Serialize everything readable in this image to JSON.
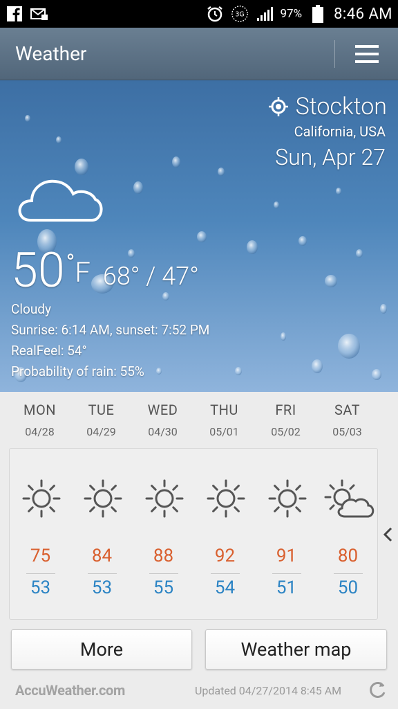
{
  "status_bar": {
    "icons": [
      "facebook-icon",
      "email-notification-icon",
      "alarm-icon",
      "network-3g-icon",
      "signal-icon",
      "battery-icon"
    ],
    "battery": "97%",
    "time": "8:46 AM"
  },
  "action_bar": {
    "title": "Weather",
    "menu_icon": "hamburger-menu-icon"
  },
  "current": {
    "city": "Stockton",
    "region": "California, USA",
    "date": "Sun, Apr 27",
    "temp": "50",
    "deg_symbol": "°",
    "unit": "F",
    "hilo": "68° / 47°",
    "condition": "Cloudy",
    "sunrise_line": "Sunrise: 6:14  AM, sunset: 7:52  PM",
    "realfeel": "RealFeel: 54°",
    "rain": "Probability of rain: 55%",
    "icon": "cloud-icon"
  },
  "forecast": [
    {
      "day": "MON",
      "date": "04/28",
      "high": "75",
      "low": "53",
      "icon": "sun-icon"
    },
    {
      "day": "TUE",
      "date": "04/29",
      "high": "84",
      "low": "53",
      "icon": "sun-icon"
    },
    {
      "day": "WED",
      "date": "04/30",
      "high": "88",
      "low": "55",
      "icon": "sun-icon"
    },
    {
      "day": "THU",
      "date": "05/01",
      "high": "92",
      "low": "54",
      "icon": "sun-icon"
    },
    {
      "day": "FRI",
      "date": "05/02",
      "high": "91",
      "low": "51",
      "icon": "sun-icon"
    },
    {
      "day": "SAT",
      "date": "05/03",
      "high": "80",
      "low": "50",
      "icon": "partly-cloudy-icon"
    }
  ],
  "buttons": {
    "more": "More",
    "map": "Weather map"
  },
  "footer": {
    "brand": "AccuWeather.com",
    "updated": "Updated 04/27/2014 8:45 AM"
  },
  "colors": {
    "high": "#d9602f",
    "low": "#2c84c4",
    "action_bar": "#5c7185"
  }
}
